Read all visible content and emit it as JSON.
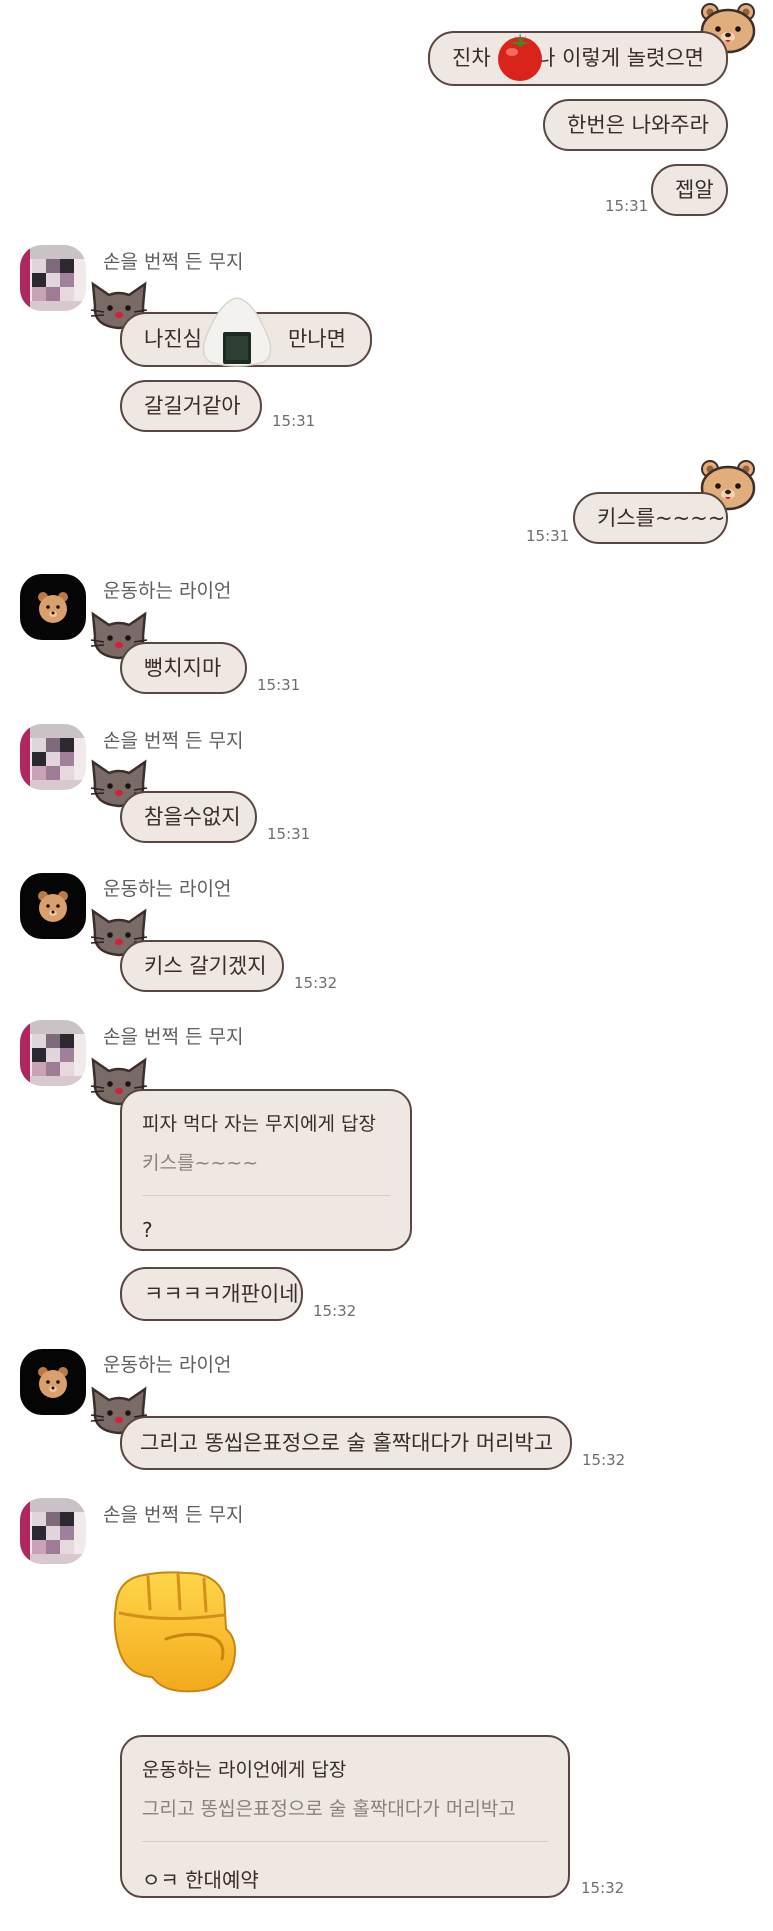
{
  "senders": {
    "muzi": "손을 번쩍 든 무지",
    "ryan": "운동하는 라이언"
  },
  "colors": {
    "bubble_bg": "#efe7e2",
    "bubble_border": "#5a4640",
    "background": "#ffffff"
  },
  "messages": {
    "m1": {
      "before": "진차",
      "after": "나 이렇게 놀렷으면",
      "emoji": "tomato"
    },
    "m2": {
      "text": "한번은 나와주라"
    },
    "m3": {
      "text": "젭알",
      "time": "15:31"
    },
    "m4": {
      "before": "나진심 ",
      "after": "만나면",
      "emoji": "rice-ball"
    },
    "m5": {
      "text": "갈길거같아",
      "time": "15:31"
    },
    "m6": {
      "text": "키스를~~~~",
      "time": "15:31"
    },
    "m7": {
      "text": "뻥치지마",
      "time": "15:31"
    },
    "m8": {
      "text": "참을수없지",
      "time": "15:31"
    },
    "m9": {
      "text": "키스 갈기겠지",
      "time": "15:32"
    },
    "m10": {
      "reply_title": "피자 먹다 자는 무지에게 답장",
      "reply_quote": "키스를~~~~",
      "text": "?"
    },
    "m11": {
      "text": "ㅋㅋㅋㅋ개판이네",
      "time": "15:32"
    },
    "m12": {
      "text": "그리고 똥씹은표정으로 술 홀짝대다가 머리박고",
      "time": "15:32"
    },
    "m13": {
      "emoji": "fist"
    },
    "m14": {
      "reply_title": "운동하는 라이언에게 답장",
      "reply_quote": "그리고 똥씹은표정으로 술 홀짝대다가 머리박고",
      "text": "ㅇㅋ 한대예약",
      "time": "15:32"
    }
  }
}
